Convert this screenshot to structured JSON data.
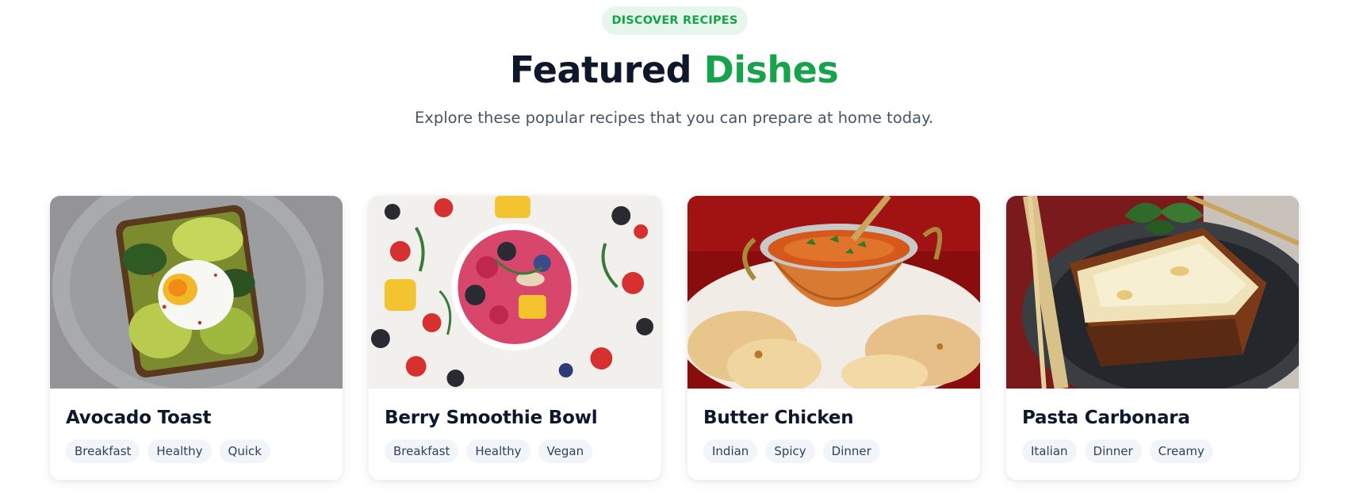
{
  "header": {
    "badge": "DISCOVER RECIPES",
    "title_main": "Featured",
    "title_accent": "Dishes",
    "subtitle": "Explore these popular recipes that you can prepare at home today."
  },
  "colors": {
    "accent": "#16a34a",
    "badge_bg": "#e6f6ec",
    "heading": "#0f172a",
    "muted_text": "#475569",
    "tag_bg": "#f1f5f9"
  },
  "cards": [
    {
      "title": "Avocado Toast",
      "tags": [
        "Breakfast",
        "Healthy",
        "Quick"
      ]
    },
    {
      "title": "Berry Smoothie Bowl",
      "tags": [
        "Breakfast",
        "Healthy",
        "Vegan"
      ]
    },
    {
      "title": "Butter Chicken",
      "tags": [
        "Indian",
        "Spicy",
        "Dinner"
      ]
    },
    {
      "title": "Pasta Carbonara",
      "tags": [
        "Italian",
        "Dinner",
        "Creamy"
      ]
    }
  ]
}
